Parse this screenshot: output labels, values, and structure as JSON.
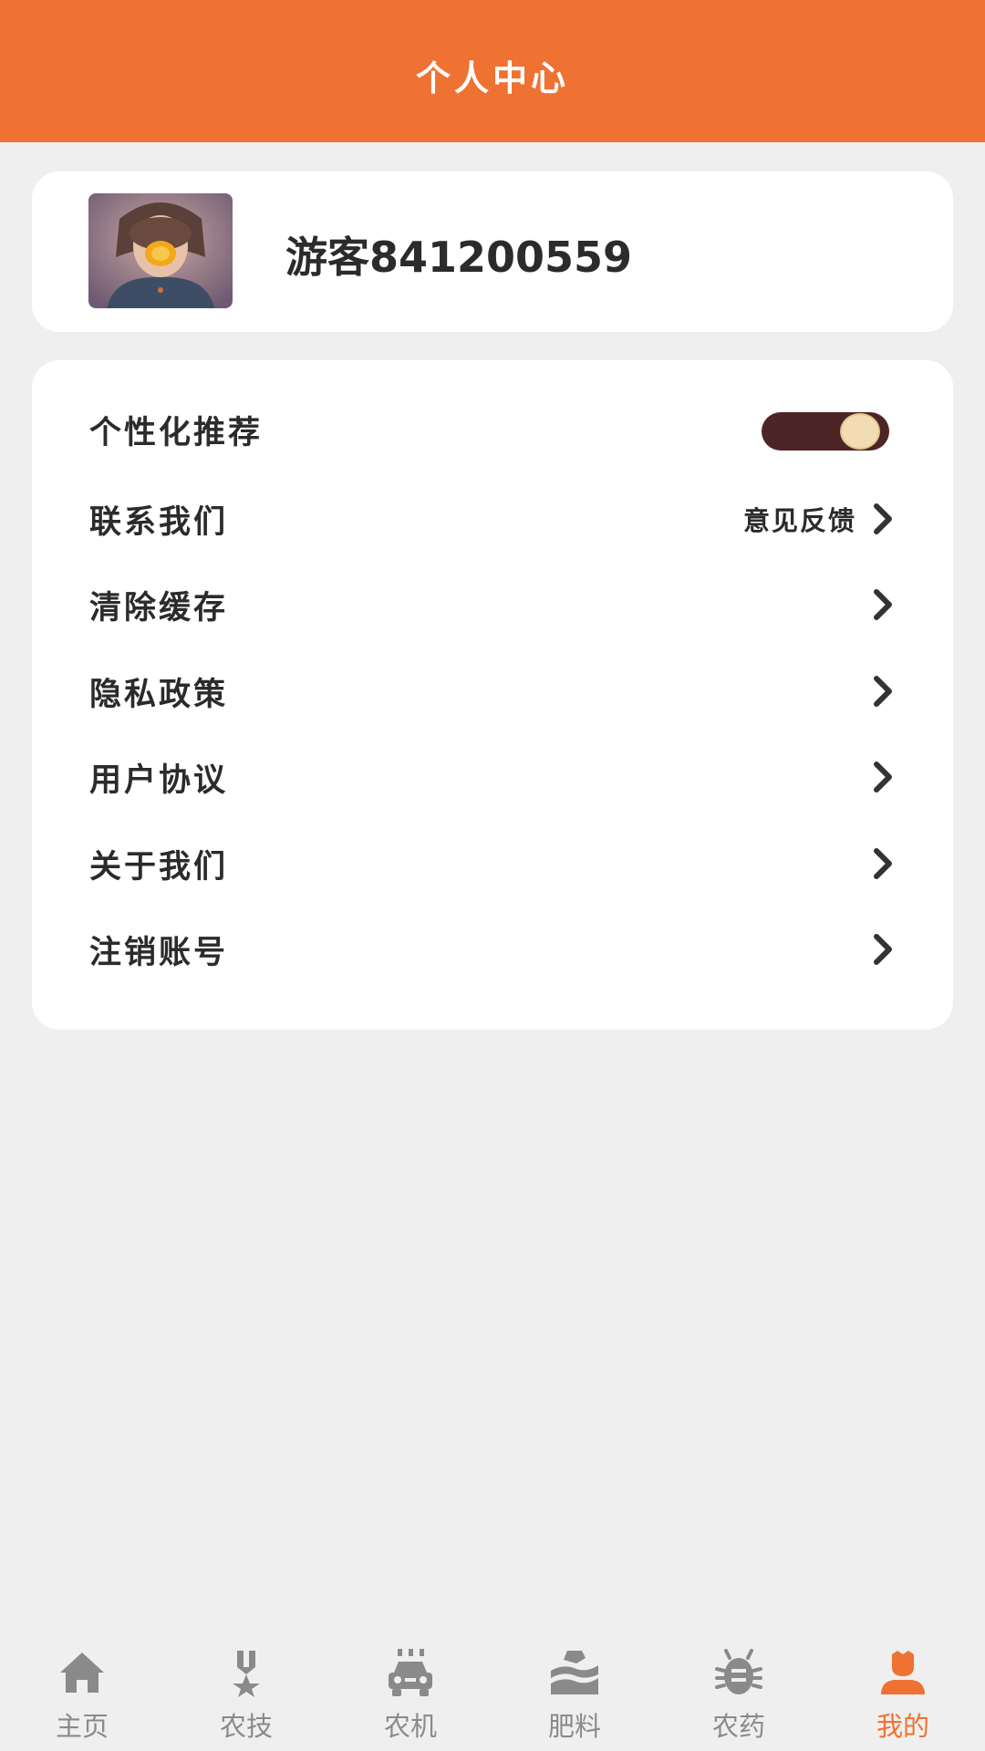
{
  "header": {
    "title": "个人中心"
  },
  "profile": {
    "username": "游客841200559"
  },
  "menu": {
    "personalized_label": "个性化推荐",
    "personalized_enabled": true,
    "contact_label": "联系我们",
    "contact_extra": "意见反馈",
    "clear_cache_label": "清除缓存",
    "privacy_label": "隐私政策",
    "agreement_label": "用户协议",
    "about_label": "关于我们",
    "delete_account_label": "注销账号"
  },
  "tabbar": {
    "items": [
      {
        "label": "主页",
        "icon": "home-icon"
      },
      {
        "label": "农技",
        "icon": "medal-icon"
      },
      {
        "label": "农机",
        "icon": "car-icon"
      },
      {
        "label": "肥料",
        "icon": "fertilizer-icon"
      },
      {
        "label": "农药",
        "icon": "bug-icon"
      },
      {
        "label": "我的",
        "icon": "user-icon",
        "active": true
      }
    ],
    "active_color": "#f07232",
    "inactive_color": "#8a8a8a"
  },
  "colors": {
    "brand": "#f07232",
    "background": "#efefef",
    "toggle_track": "#4e2527"
  }
}
